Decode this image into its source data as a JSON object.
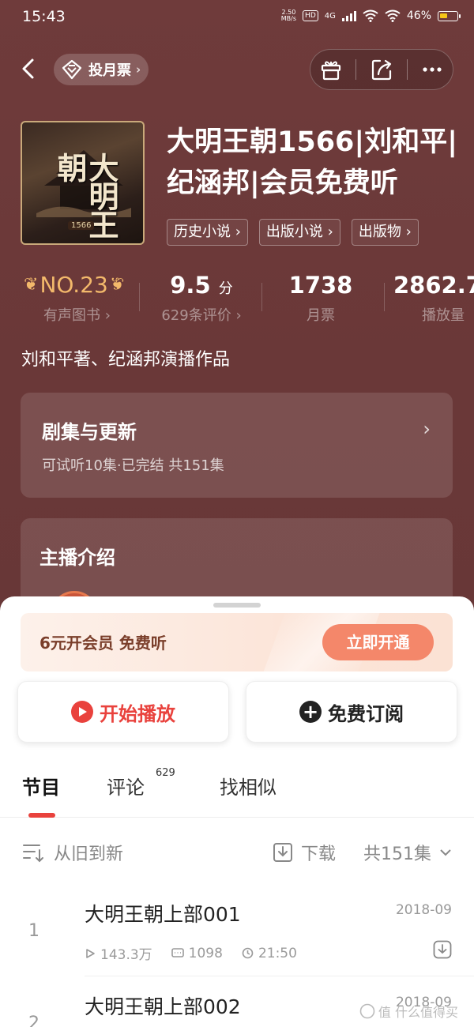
{
  "status_bar": {
    "time": "15:43",
    "net_speed_top": "2.50",
    "net_speed_bottom": "MB/s",
    "hd": "HD",
    "network": "4G",
    "battery": "46%"
  },
  "nav": {
    "vote_label": "投月票"
  },
  "book": {
    "title": "大明王朝1566|刘和平|纪涵邦|会员免费听",
    "cover_text": "大明王朝",
    "cover_sub": "1566",
    "tags": [
      "历史小说",
      "出版小说",
      "出版物"
    ]
  },
  "stats": {
    "rank": {
      "value": "NO.23",
      "label": "有声图书"
    },
    "rating": {
      "value": "9.5",
      "unit": "分",
      "label": "629条评价"
    },
    "monthly_votes": {
      "value": "1738",
      "label": "月票"
    },
    "plays": {
      "value": "2862.7",
      "label": "播放量"
    }
  },
  "author_line": "刘和平著、纪涵邦演播作品",
  "episodes_card": {
    "title": "剧集与更新",
    "subtitle": "可试听10集·已完结 共151集"
  },
  "host_card": {
    "title": "主播介绍"
  },
  "sheet": {
    "vip_text": "6元开会员 免费听",
    "vip_button": "立即开通",
    "play_button": "开始播放",
    "subscribe_button": "免费订阅",
    "tabs": [
      {
        "label": "节目"
      },
      {
        "label": "评论",
        "count": "629"
      },
      {
        "label": "找相似"
      }
    ],
    "sort_label": "从旧到新",
    "download_label": "下载",
    "total_label": "共151集"
  },
  "episodes": [
    {
      "num": "1",
      "name": "大明王朝上部001",
      "date": "2018-09",
      "plays": "143.3万",
      "comments": "1098",
      "duration": "21:50"
    },
    {
      "num": "2",
      "name": "大明王朝上部002",
      "date": "2018-09"
    }
  ],
  "watermark": "值 什么值得买",
  "colors": {
    "background": "#6b3838",
    "accent_red": "#e9423d",
    "gold": "#f3b96b",
    "vip_button": "#f4876a"
  }
}
